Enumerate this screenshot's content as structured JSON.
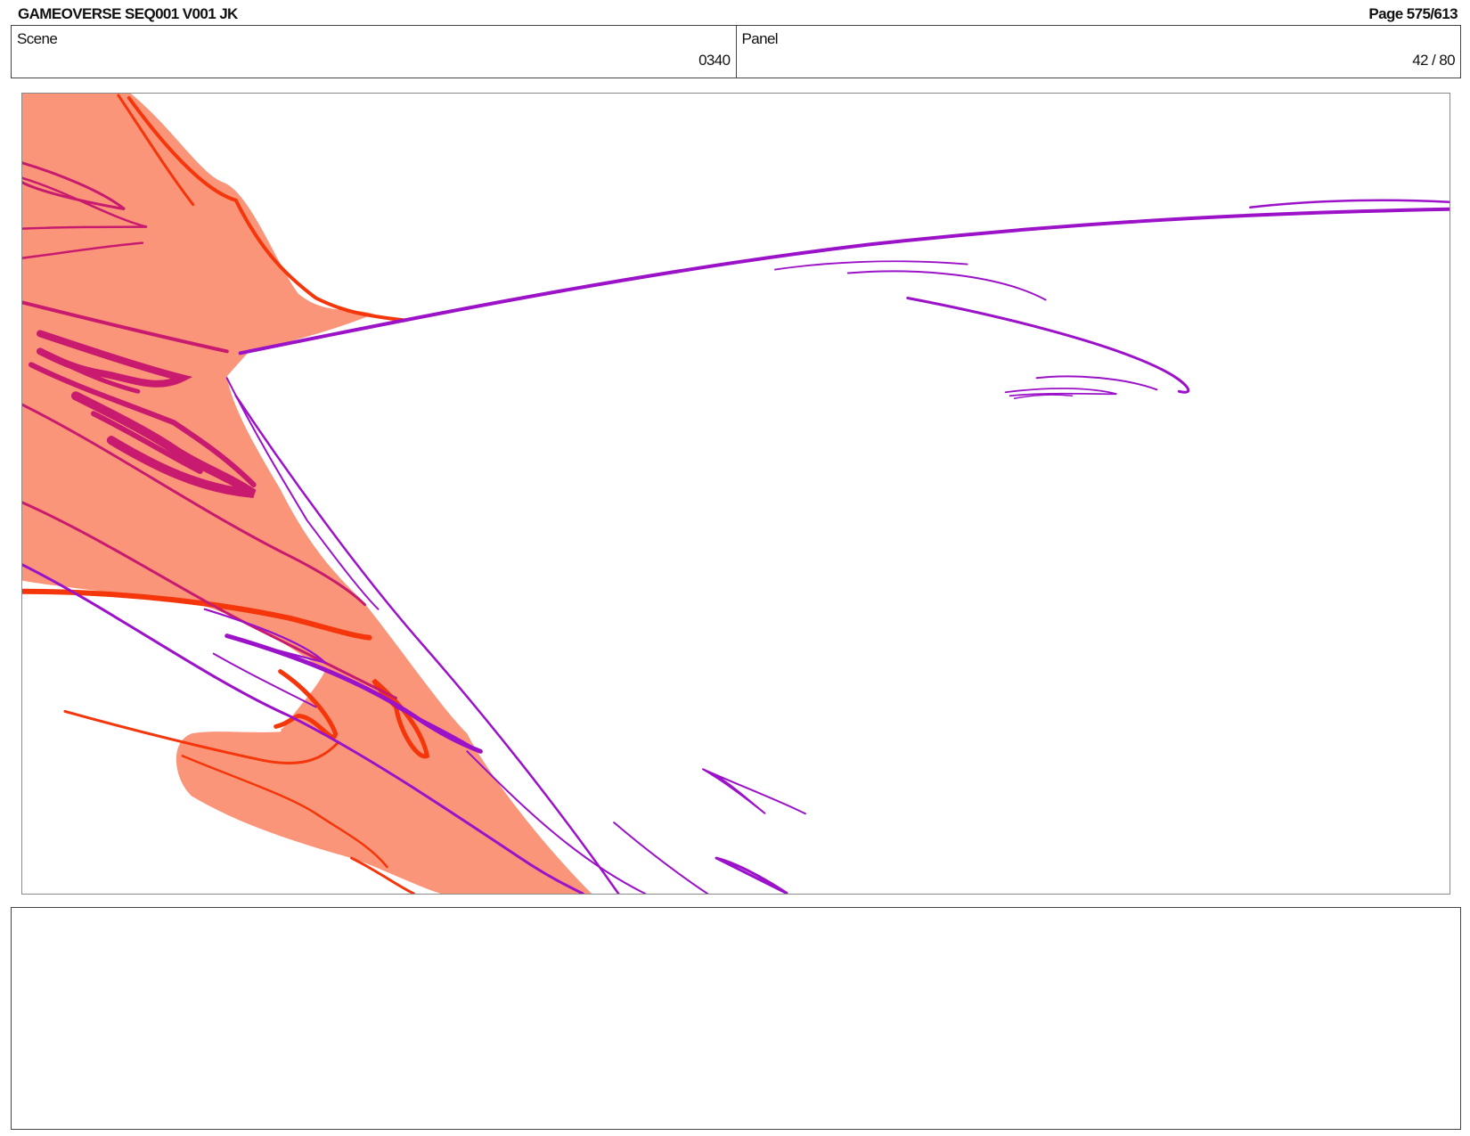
{
  "header": {
    "title": "GAMEOVERSE SEQ001 V001 JK",
    "page": "Page 575/613"
  },
  "info": {
    "scene_label": "Scene",
    "scene_value": "0340",
    "panel_label": "Panel",
    "panel_value": "42 / 80"
  },
  "drawing": {
    "colors": {
      "fill": "#fa957a",
      "red_stroke": "#f5350a",
      "magenta_stroke": "#c81a6e",
      "purple_stroke": "#9b12c8"
    }
  },
  "notes": {
    "text": ""
  }
}
